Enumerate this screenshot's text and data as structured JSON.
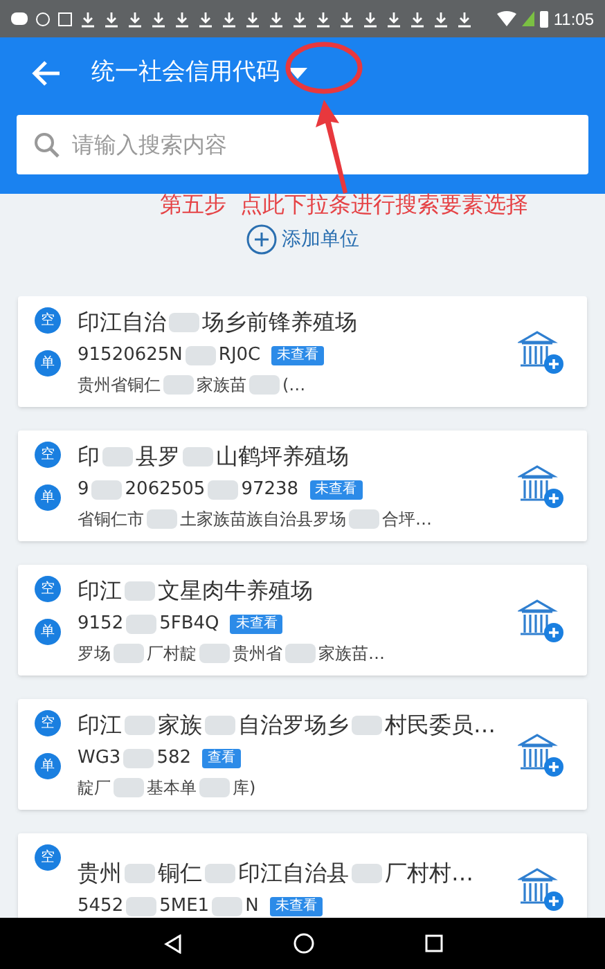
{
  "status_bar": {
    "time": "11:05"
  },
  "header": {
    "title": "统一社会信用代码",
    "search": {
      "placeholder": "请输入搜索内容"
    }
  },
  "annotation": {
    "text": "第五步  点此下拉条进行搜索要素选择"
  },
  "add_unit": {
    "label": "添加单位"
  },
  "units": [
    {
      "badges": [
        "空",
        "单"
      ],
      "name": [
        "印江自治",
        "场乡前锋养殖场"
      ],
      "code": [
        "91520625N",
        "RJ0C"
      ],
      "tag": "未查看",
      "address": [
        "贵州省铜仁",
        "家族苗",
        "(…"
      ]
    },
    {
      "badges": [
        "空",
        "单"
      ],
      "name": [
        "印",
        "县罗",
        "山鹤坪养殖场"
      ],
      "code": [
        "9",
        "2062505",
        "97238"
      ],
      "tag": "未查看",
      "address": [
        "省铜仁市",
        "土家族苗族自治县罗场",
        "合坪…"
      ]
    },
    {
      "badges": [
        "空",
        "单"
      ],
      "name": [
        "印江",
        "文星肉牛养殖场"
      ],
      "code": [
        "9152",
        "5FB4Q"
      ],
      "tag": "未查看",
      "address": [
        "罗场",
        "厂村靛",
        "贵州省",
        "家族苗…"
      ]
    },
    {
      "badges": [
        "空",
        "单"
      ],
      "name": [
        "印江",
        "家族",
        "自治罗场乡",
        "村民委员…"
      ],
      "code": [
        "WG3",
        "582"
      ],
      "tag": "查看",
      "address": [
        "靛厂",
        "基本单",
        "库)"
      ]
    },
    {
      "badges": [
        "空"
      ],
      "name": [
        "贵州",
        "铜仁",
        "印江自治县",
        "厂村村…"
      ],
      "code": [
        "5452",
        "5ME1",
        "N"
      ],
      "tag": "未查看"
    }
  ]
}
